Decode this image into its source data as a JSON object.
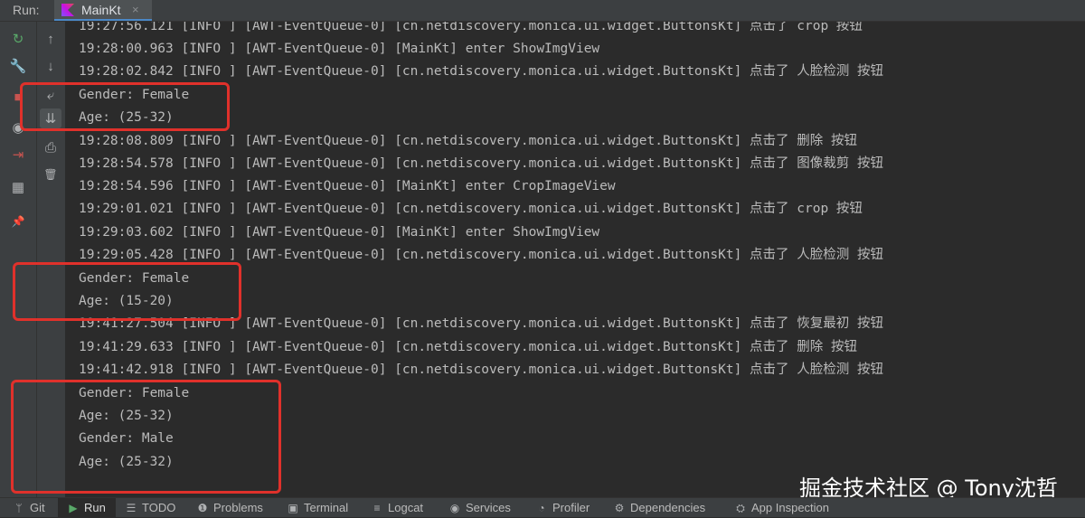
{
  "header": {
    "run_label": "Run:",
    "tab_title": "MainKt",
    "tab_close": "×"
  },
  "toolbar_outer": [
    {
      "icon": "rerun-icon",
      "glyph": "↻"
    },
    {
      "icon": "wrench-icon",
      "glyph": "🔧"
    },
    {
      "icon": "stop-icon",
      "glyph": "■"
    },
    {
      "icon": "camera-icon",
      "glyph": "◉"
    },
    {
      "icon": "exit-icon",
      "glyph": "⇥"
    },
    {
      "icon": "layout-icon",
      "glyph": "▦"
    },
    {
      "icon": "pin-icon",
      "glyph": "📌"
    }
  ],
  "toolbar_inner": [
    {
      "icon": "arrow-up-icon",
      "glyph": "↑"
    },
    {
      "icon": "arrow-down-icon",
      "glyph": "↓"
    },
    {
      "icon": "soft-wrap-icon",
      "glyph": "⤶"
    },
    {
      "icon": "scroll-to-end-icon",
      "glyph": "⇊"
    },
    {
      "icon": "print-icon",
      "glyph": "⎙"
    },
    {
      "icon": "trash-icon",
      "glyph": "🗑"
    }
  ],
  "console_lines": [
    "19:27:56.121 [INFO ] [AWT-EventQueue-0] [cn.netdiscovery.monica.ui.widget.ButtonsKt] 点击了 crop 按钮",
    "19:28:00.963 [INFO ] [AWT-EventQueue-0] [MainKt] enter ShowImgView",
    "19:28:02.842 [INFO ] [AWT-EventQueue-0] [cn.netdiscovery.monica.ui.widget.ButtonsKt] 点击了 人脸检测 按钮",
    "Gender: Female",
    "Age: (25-32)",
    "19:28:08.809 [INFO ] [AWT-EventQueue-0] [cn.netdiscovery.monica.ui.widget.ButtonsKt] 点击了 删除 按钮",
    "19:28:54.578 [INFO ] [AWT-EventQueue-0] [cn.netdiscovery.monica.ui.widget.ButtonsKt] 点击了 图像裁剪 按钮",
    "19:28:54.596 [INFO ] [AWT-EventQueue-0] [MainKt] enter CropImageView",
    "19:29:01.021 [INFO ] [AWT-EventQueue-0] [cn.netdiscovery.monica.ui.widget.ButtonsKt] 点击了 crop 按钮",
    "19:29:03.602 [INFO ] [AWT-EventQueue-0] [MainKt] enter ShowImgView",
    "19:29:05.428 [INFO ] [AWT-EventQueue-0] [cn.netdiscovery.monica.ui.widget.ButtonsKt] 点击了 人脸检测 按钮",
    "Gender: Female",
    "Age: (15-20)",
    "19:41:27.504 [INFO ] [AWT-EventQueue-0] [cn.netdiscovery.monica.ui.widget.ButtonsKt] 点击了 恢复最初 按钮",
    "19:41:29.633 [INFO ] [AWT-EventQueue-0] [cn.netdiscovery.monica.ui.widget.ButtonsKt] 点击了 删除 按钮",
    "19:41:42.918 [INFO ] [AWT-EventQueue-0] [cn.netdiscovery.monica.ui.widget.ButtonsKt] 点击了 人脸检测 按钮",
    "Gender: Female",
    "Age: (25-32)",
    "Gender: Male",
    "Age: (25-32)"
  ],
  "watermark": "掘金技术社区 @ Tony沈哲",
  "bottom_tabs": [
    {
      "name": "git",
      "icon": "git-branch-icon",
      "glyph": "ᛘ",
      "label": "Git"
    },
    {
      "name": "run",
      "icon": "run-icon",
      "glyph": "▶",
      "label": "Run"
    },
    {
      "name": "todo",
      "icon": "todo-list-icon",
      "glyph": "☰",
      "label": "TODO"
    },
    {
      "name": "problems",
      "icon": "problems-icon",
      "glyph": "❶",
      "label": "Problems"
    },
    {
      "name": "terminal",
      "icon": "terminal-icon",
      "glyph": "▣",
      "label": "Terminal"
    },
    {
      "name": "logcat",
      "icon": "logcat-icon",
      "glyph": "≡",
      "label": "Logcat"
    },
    {
      "name": "services",
      "icon": "services-icon",
      "glyph": "◉",
      "label": "Services"
    },
    {
      "name": "profiler",
      "icon": "profiler-icon",
      "glyph": "◔",
      "label": "Profiler"
    },
    {
      "name": "dependencies",
      "icon": "dependencies-icon",
      "glyph": "⚙",
      "label": "Dependencies"
    },
    {
      "name": "app-inspection",
      "icon": "app-inspection-icon",
      "glyph": "⛭",
      "label": "App Inspection"
    }
  ],
  "colors": {
    "console_bg": "#2b2b2b",
    "panel_bg": "#3c3f41",
    "text": "#bbbbbb",
    "annotation_red": "#e0312b",
    "run_green": "#59a869"
  }
}
